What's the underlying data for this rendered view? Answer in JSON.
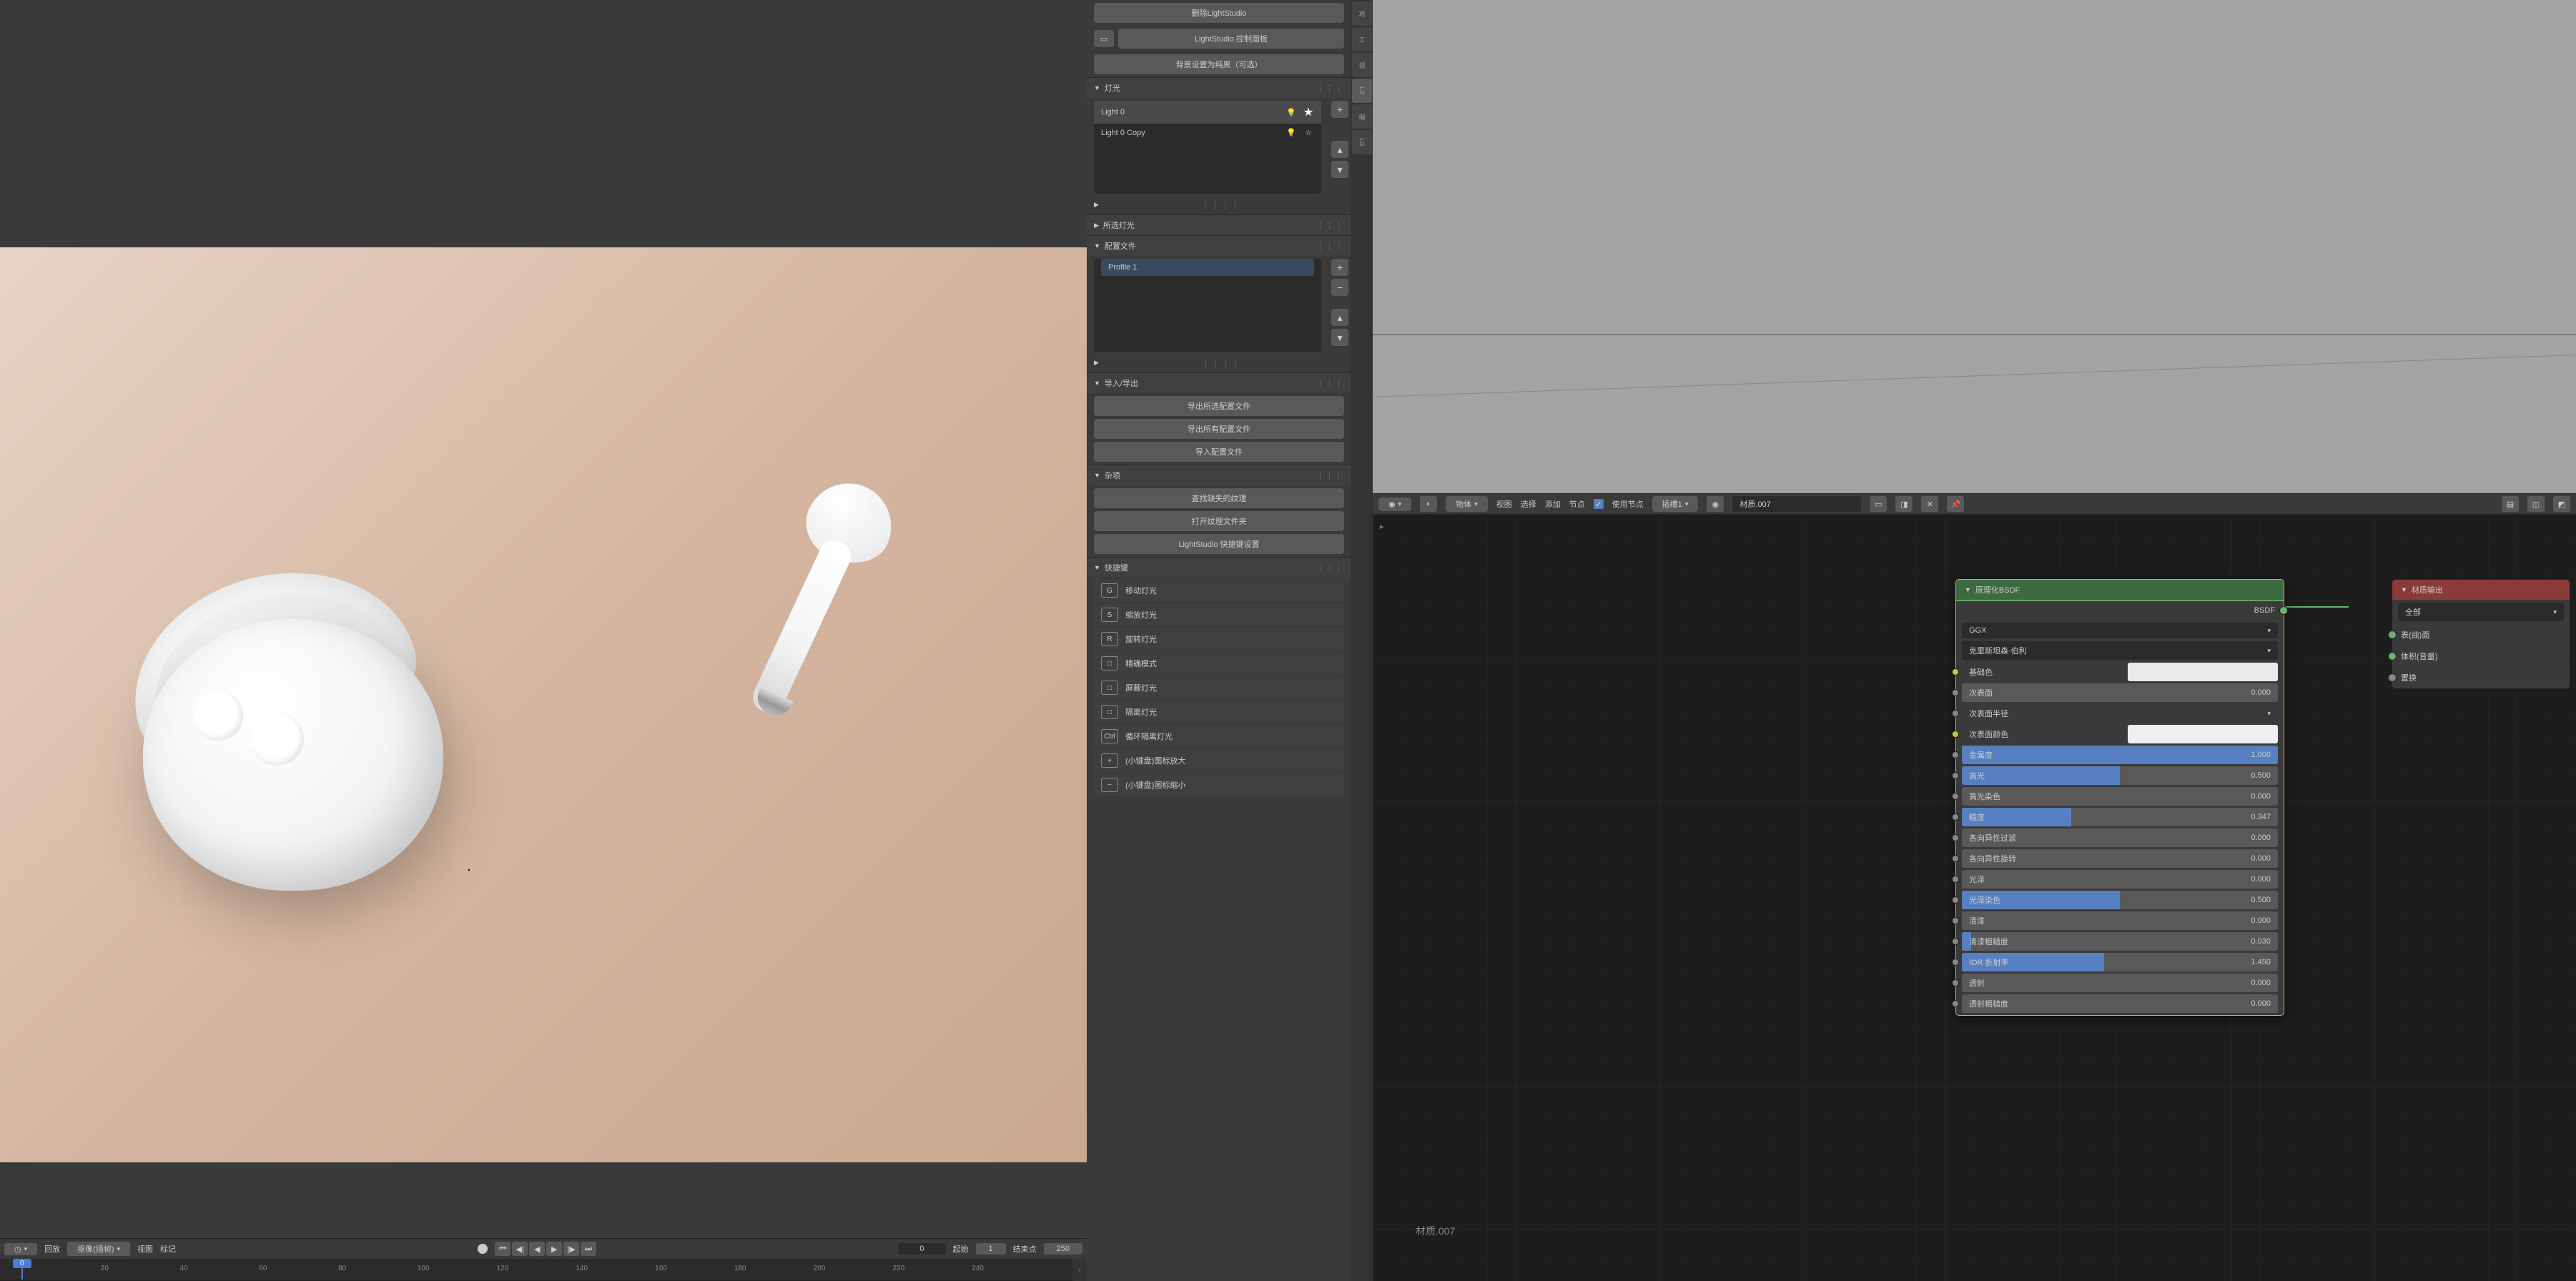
{
  "lightstudio": {
    "remove_btn": "删除LightStudio",
    "control_panel_btn": "LightStudio 控制面板",
    "bg_btn": "背景设置为纯黑（可选）",
    "lights_hdr": "灯光",
    "lights": [
      {
        "name": "Light 0",
        "star": true
      },
      {
        "name": "Light 0 Copy",
        "star": false
      }
    ],
    "selected_hdr": "所选灯光",
    "profile_hdr": "配置文件",
    "profile_item": "Profile 1",
    "io_hdr": "导入/导出",
    "io_items": [
      "导出所选配置文件",
      "导出所有配置文件",
      "导入配置文件"
    ],
    "misc_hdr": "杂项",
    "misc_items": [
      "查找缺失的纹理",
      "打开纹理文件夹",
      "LightStudio 快捷键设置"
    ],
    "shortcut_hdr": "快捷键",
    "shortcuts": [
      {
        "key": "G",
        "label": "移动灯光"
      },
      {
        "key": "S",
        "label": "缩放灯光"
      },
      {
        "key": "R",
        "label": "旋转灯光"
      },
      {
        "key": "□",
        "label": "精确模式"
      },
      {
        "key": "□",
        "label": "屏蔽灯光"
      },
      {
        "key": "□",
        "label": "隔离灯光"
      },
      {
        "key": "Ctrl",
        "label": "循环隔离灯光"
      },
      {
        "key": "+",
        "label": "(小键盘)图标放大"
      },
      {
        "key": "−",
        "label": "(小键盘)图标缩小"
      }
    ]
  },
  "node_editor": {
    "mode": "物体",
    "menus": [
      "视图",
      "选择",
      "添加",
      "节点"
    ],
    "use_nodes_label": "使用节点",
    "slot": "插槽1",
    "material": "材质.007",
    "bsdf_title": "原理化BSDF",
    "bsdf_out": "BSDF",
    "dist": "GGX",
    "subsurf_method": "克里斯坦森·伯利",
    "props": [
      {
        "name": "基础色",
        "type": "color",
        "socket": "y",
        "color": "#eaeaea"
      },
      {
        "name": "次表面",
        "type": "slider",
        "val": "0.000",
        "fill": 0
      },
      {
        "name": "次表面半径",
        "type": "dropdown"
      },
      {
        "name": "次表面颜色",
        "type": "color",
        "socket": "y",
        "color": "#efefef"
      },
      {
        "name": "金属度",
        "type": "slider",
        "val": "1.000",
        "fill": 100
      },
      {
        "name": "高光",
        "type": "slider",
        "val": "0.500",
        "fill": 50
      },
      {
        "name": "高光染色",
        "type": "slider",
        "val": "0.000",
        "fill": 0
      },
      {
        "name": "糙度",
        "type": "slider",
        "val": "0.347",
        "fill": 34.7
      },
      {
        "name": "各向异性过滤",
        "type": "slider",
        "val": "0.000",
        "fill": 0
      },
      {
        "name": "各向异性旋转",
        "type": "slider",
        "val": "0.000",
        "fill": 0
      },
      {
        "name": "光泽",
        "type": "slider",
        "val": "0.000",
        "fill": 0
      },
      {
        "name": "光泽染色",
        "type": "slider",
        "val": "0.500",
        "fill": 50
      },
      {
        "name": "清漆",
        "type": "slider",
        "val": "0.000",
        "fill": 0
      },
      {
        "name": "清漆粗糙度",
        "type": "slider",
        "val": "0.030",
        "fill": 3
      },
      {
        "name": "IOR 折射率",
        "type": "slider",
        "val": "1.450",
        "fill": 45
      },
      {
        "name": "透射",
        "type": "slider",
        "val": "0.000",
        "fill": 0
      },
      {
        "name": "透射粗糙度",
        "type": "slider",
        "val": "0.000",
        "fill": 0
      }
    ],
    "output_title": "材质输出",
    "output_mode": "全部",
    "output_sockets": [
      "表(曲)面",
      "体积(音量)",
      "置换"
    ]
  },
  "timeline": {
    "playback": "回放",
    "keying": "抠像(插帧)",
    "menus": [
      "视图",
      "标记"
    ],
    "current": "0",
    "start_lbl": "起始",
    "start": "1",
    "end_lbl": "结束点",
    "end": "250",
    "ticks": [
      "20",
      "40",
      "60",
      "80",
      "100",
      "120",
      "140",
      "160",
      "180",
      "200",
      "220",
      "240"
    ]
  }
}
